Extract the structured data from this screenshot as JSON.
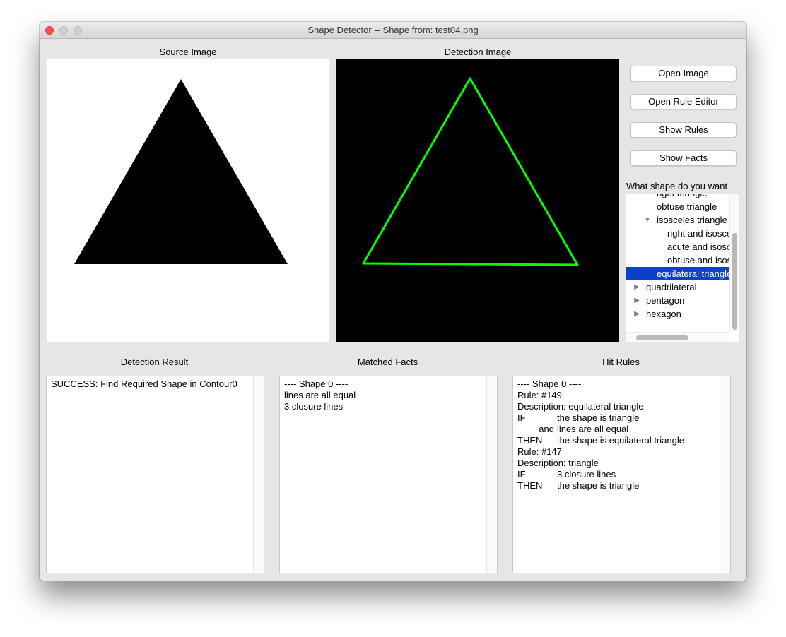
{
  "window": {
    "title": "Shape Detector -- Shape from: test04.png",
    "controls": [
      "close",
      "minimize",
      "maximize"
    ]
  },
  "source_panel": {
    "label": "Source Image",
    "background": "#ffffff",
    "shape_color": "#000000",
    "shape": "filled equilateral triangle"
  },
  "detection_panel": {
    "label": "Detection Image",
    "background": "#000000",
    "outline_color": "#00ff00",
    "shape": "outlined triangle contour"
  },
  "buttons": {
    "open_image": "Open Image",
    "open_rule_editor": "Open Rule Editor",
    "show_rules": "Show Rules",
    "show_facts": "Show Facts"
  },
  "shape_tree": {
    "label": "What shape do you want",
    "selected_color": "#0b3fcc",
    "items": [
      {
        "label": "right triangle",
        "level": 2,
        "toggle": ""
      },
      {
        "label": "obtuse triangle",
        "level": 2,
        "toggle": ""
      },
      {
        "label": "isosceles triangle",
        "level": 2,
        "toggle": "expanded"
      },
      {
        "label": "right and isosceles triangle",
        "level": 3,
        "toggle": ""
      },
      {
        "label": "acute and isosceles triangle",
        "level": 3,
        "toggle": ""
      },
      {
        "label": "obtuse and isosceles triangle",
        "level": 3,
        "toggle": ""
      },
      {
        "label": "equilateral triangle",
        "level": 2,
        "toggle": "",
        "selected": true
      },
      {
        "label": "quadrilateral",
        "level": 1,
        "toggle": "collapsed"
      },
      {
        "label": "pentagon",
        "level": 1,
        "toggle": "collapsed"
      },
      {
        "label": "hexagon",
        "level": 1,
        "toggle": "collapsed"
      }
    ]
  },
  "detection_result": {
    "label": "Detection Result",
    "lines": [
      "SUCCESS: Find Required Shape in Contour0"
    ]
  },
  "matched_facts": {
    "label": "Matched Facts",
    "lines": [
      "---- Shape 0 ----",
      "lines are all equal",
      "3 closure lines"
    ]
  },
  "hit_rules": {
    "label": "Hit Rules",
    "lines": [
      {
        "kw": "",
        "text": "---- Shape 0 ----"
      },
      {
        "kw": "",
        "text": "Rule: #149"
      },
      {
        "kw": "",
        "text": "Description: equilateral triangle"
      },
      {
        "kw": "IF",
        "text": "the shape is triangle"
      },
      {
        "kw": "and",
        "text": "lines are all equal",
        "indent": true
      },
      {
        "kw": "THEN",
        "text": "the shape is equilateral triangle"
      },
      {
        "kw": "",
        "text": "Rule: #147"
      },
      {
        "kw": "",
        "text": "Description: triangle"
      },
      {
        "kw": "IF",
        "text": "3 closure lines"
      },
      {
        "kw": "THEN",
        "text": "the shape is triangle"
      }
    ]
  }
}
